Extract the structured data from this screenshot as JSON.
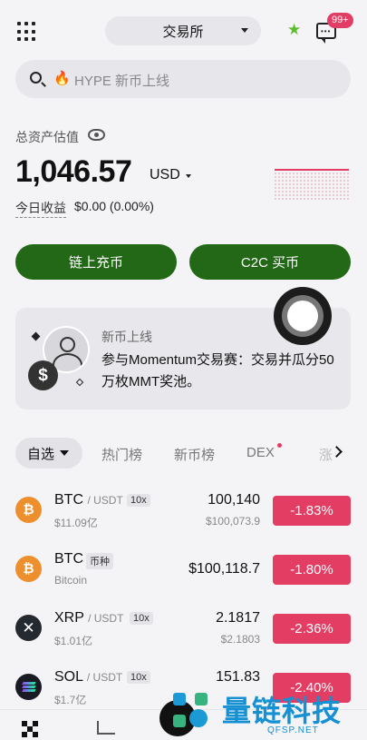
{
  "header": {
    "exchange_label": "交易所",
    "badge": "99+",
    "icons": [
      "grid-icon",
      "star-icon",
      "message-icon"
    ]
  },
  "search": {
    "placeholder": "HYPE 新币上线",
    "icon": "fire-icon"
  },
  "assets": {
    "label": "总资产估值",
    "balance": "1,046.57",
    "currency": "USD",
    "pnl_label": "今日收益",
    "pnl_value": "$0.00 (0.00%)"
  },
  "actions": {
    "deposit": "链上充币",
    "c2c": "C2C 买币"
  },
  "promo": {
    "tag": "新币上线",
    "text": "参与Momentum交易赛：交易并瓜分50万枚MMT奖池。",
    "coin_symbol": "$"
  },
  "tabs": {
    "active": "自选",
    "items": [
      "热门榜",
      "新币榜",
      "DEX"
    ],
    "overflow": "涨"
  },
  "market": [
    {
      "base": "BTC",
      "quote": "/ USDT",
      "lev": "10x",
      "sub": "$11.09亿",
      "price": "100,140",
      "price_sub": "$100,073.9",
      "change": "-1.83%"
    },
    {
      "base": "BTC",
      "tag": "币种",
      "sub": "Bitcoin",
      "price": "$100,118.7",
      "change": "-1.80%"
    },
    {
      "base": "XRP",
      "quote": "/ USDT",
      "lev": "10x",
      "sub": "$1.01亿",
      "price": "2.1817",
      "price_sub": "$2.1803",
      "change": "-2.36%"
    },
    {
      "base": "SOL",
      "quote": "/ USDT",
      "lev": "10x",
      "sub": "$1.7亿",
      "price": "151.83",
      "change": "-2.40%"
    }
  ],
  "watermark": {
    "text": "量链科技",
    "url": "QFSP.NET"
  },
  "colors": {
    "accent_green": "#226816",
    "down_red": "#e33d63",
    "badge_red": "#e23d64",
    "star_green": "#5bbd2c"
  }
}
